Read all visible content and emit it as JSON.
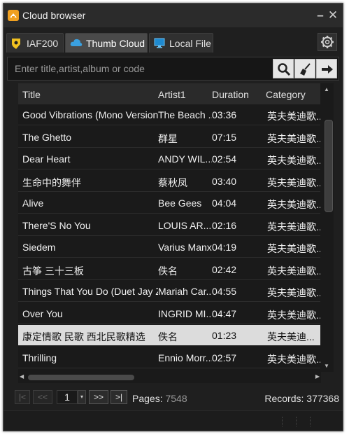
{
  "window": {
    "title": "Cloud browser",
    "minimize_glyph": "–",
    "close_glyph": "✕"
  },
  "tabs": [
    {
      "label": "IAF200",
      "icon": "shield-badge-icon",
      "active": false
    },
    {
      "label": "Thumb Cloud",
      "icon": "cloud-icon",
      "active": true
    },
    {
      "label": "Local File",
      "icon": "monitor-icon",
      "active": false
    }
  ],
  "search": {
    "placeholder": "Enter title,artist,album or code",
    "value": ""
  },
  "table": {
    "columns": [
      "Title",
      "Artist1",
      "Duration",
      "Category"
    ],
    "rows": [
      {
        "title": "Good Vibrations (Mono Version)",
        "artist": "The Beach ...",
        "duration": "03:36",
        "category": "英夫美迪歌...",
        "selected": false
      },
      {
        "title": "The Ghetto",
        "artist": "群星",
        "duration": "07:15",
        "category": "英夫美迪歌...",
        "selected": false
      },
      {
        "title": "Dear Heart",
        "artist": "ANDY WIL...",
        "duration": "02:54",
        "category": "英夫美迪歌...",
        "selected": false
      },
      {
        "title": "生命中的舞伴",
        "artist": "蔡秋凤",
        "duration": "03:40",
        "category": "英夫美迪歌...",
        "selected": false
      },
      {
        "title": "Alive",
        "artist": "Bee Gees",
        "duration": "04:04",
        "category": "英夫美迪歌...",
        "selected": false
      },
      {
        "title": "There'S No You",
        "artist": "LOUIS AR...",
        "duration": "02:16",
        "category": "英夫美迪歌...",
        "selected": false
      },
      {
        "title": "Siedem",
        "artist": "Varius Manx",
        "duration": "04:19",
        "category": "英夫美迪歌...",
        "selected": false
      },
      {
        "title": "古筝 三十三板",
        "artist": "佚名",
        "duration": "02:42",
        "category": "英夫美迪歌...",
        "selected": false
      },
      {
        "title": "Things That You Do (Duet Jay Z)",
        "artist": "Mariah Car...",
        "duration": "04:55",
        "category": "英夫美迪歌...",
        "selected": false
      },
      {
        "title": "Over You",
        "artist": "INGRID MI...",
        "duration": "04:47",
        "category": "英夫美迪歌...",
        "selected": false
      },
      {
        "title": "康定情歌 民歌 西北民歌精选",
        "artist": "佚名",
        "duration": "01:23",
        "category": "英夫美迪...",
        "selected": true
      },
      {
        "title": "Thrilling",
        "artist": "Ennio Morr...",
        "duration": "02:57",
        "category": "英夫美迪歌...",
        "selected": false
      }
    ]
  },
  "pager": {
    "first": "|<",
    "prev": "<<",
    "page": "1",
    "next": ">>",
    "last": ">|",
    "pages_label": "Pages:",
    "pages_value": "7548",
    "records_label": "Records:",
    "records_value": "377368"
  },
  "colors": {
    "background": "#1f1f1f",
    "selected_row": "#dcdcdc",
    "app_icon": "#f0a020",
    "cloud_icon": "#3aa0e0"
  }
}
